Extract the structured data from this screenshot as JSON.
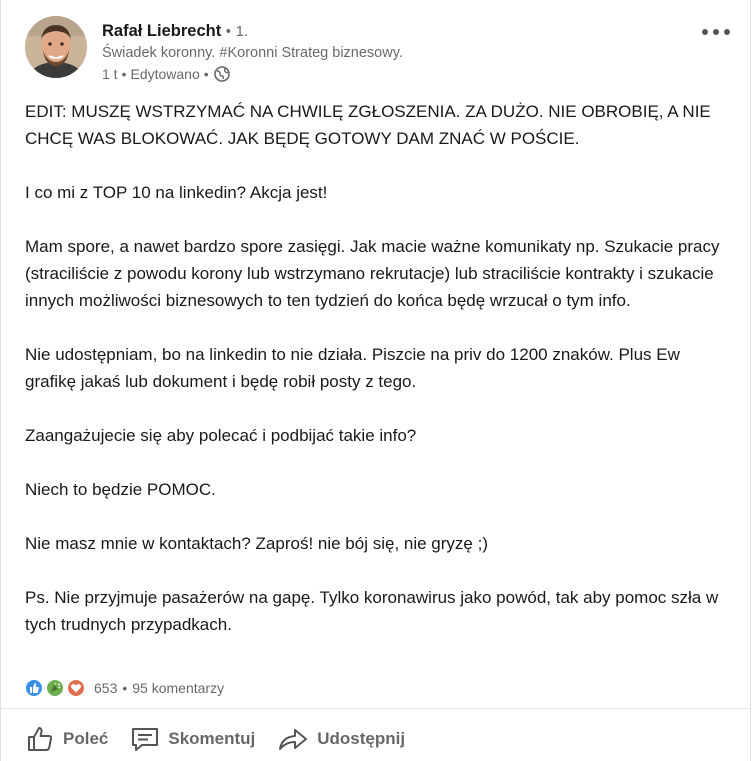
{
  "post": {
    "author": {
      "name": "Rafał Liebrecht",
      "separator": "•",
      "degree": "1.",
      "headline": "Świadek koronny. #Koronni Strateg biznesowy.",
      "time": "1 t",
      "edited": "Edytowano",
      "time_separator": "•"
    },
    "paragraphs": [
      "EDIT: MUSZĘ WSTRZYMAĆ NA CHWILĘ ZGŁOSZENIA. ZA DUŻO. NIE OBROBIĘ, A NIE CHCĘ WAS BLOKOWAĆ. JAK BĘDĘ GOTOWY DAM ZNAĆ W POŚCIE.",
      "I co mi z TOP 10 na linkedin? Akcja jest!",
      "Mam spore, a nawet bardzo spore zasięgi. Jak macie ważne komunikaty np. Szukacie pracy (straciliście z powodu korony lub wstrzymano rekrutacje) lub straciliście kontrakty i szukacie innych możliwości biznesowych to ten tydzień do końca będę wrzucał o tym info.",
      "Nie udostępniam, bo na linkedin to nie działa. Piszcie na priv do 1200 znaków. Plus Ew grafikę jakaś lub dokument i będę robił posty z tego.",
      "Zaangażujecie się aby polecać i podbijać takie info?",
      "Niech to będzie POMOC.",
      "Nie masz mnie w kontaktach? Zaproś! nie bój się, nie gryzę ;)",
      "Ps. Nie przyjmuje pasażerów na gapę. Tylko koronawirus jako powód, tak aby pomoc szła w tych trudnych przypadkach."
    ],
    "social": {
      "reaction_count": "653",
      "separator": "•",
      "comments": "95 komentarzy",
      "reaction_icons": [
        "like-icon",
        "celebrate-icon",
        "love-icon"
      ]
    },
    "actions": {
      "like": "Poleć",
      "comment": "Skomentuj",
      "share": "Udostępnij"
    },
    "icons": {
      "more": "ellipsis-icon",
      "visibility": "globe-icon"
    },
    "colors": {
      "like": "#378fe9",
      "celebrate": "#44712e",
      "love": "#df704d",
      "secondary_text": "#666666"
    }
  }
}
